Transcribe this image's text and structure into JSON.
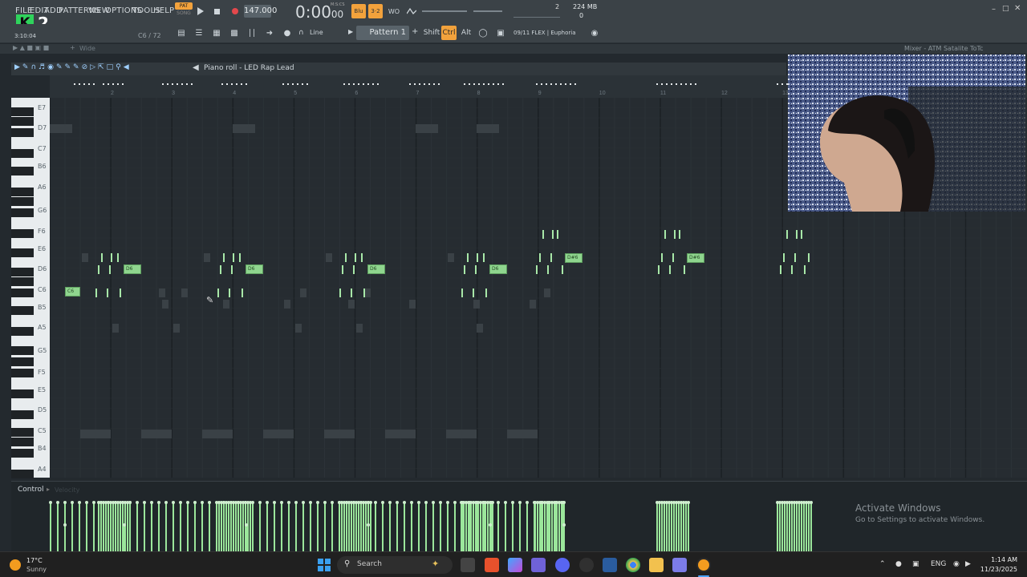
{
  "app": {
    "menu": [
      "FILE",
      "EDIT",
      "ADD",
      "PATTERNS",
      "VIEW",
      "OPTIONS",
      "TOOLS",
      "HELP"
    ],
    "pat_song": [
      "PAT",
      "SONG"
    ],
    "tempo": "147.000",
    "time_main": "0:00",
    "time_sub": "00",
    "time_unit": "M:S:CS",
    "memory": "224 MB",
    "cpu_num": "2",
    "cpu_zero": "0",
    "elapsed": "3:10:04",
    "big_number": "2",
    "note_info": "C6 / 72",
    "snap": "Line",
    "pattern": "Pattern 1",
    "shift": "Shift",
    "ctrl": "Ctrl",
    "alt": "Alt",
    "plugin_info": "09/11  FLEX | Euphoria",
    "channel_rack_label": "Wide",
    "mixer_title": "Mixer - ATM Satalite ToTc"
  },
  "piano_roll": {
    "title": "Piano roll - LED Rap Lead",
    "bar_numbers": [
      "2",
      "3",
      "4",
      "5",
      "6",
      "7",
      "8",
      "9",
      "10",
      "11",
      "12",
      "13"
    ],
    "keys": [
      "E7",
      "D7",
      "C7",
      "B6",
      "A6",
      "G6",
      "F6",
      "E6",
      "D6",
      "C6",
      "B5",
      "A5",
      "G5",
      "F5",
      "E5",
      "D5",
      "C5",
      "B4",
      "A4"
    ],
    "note_labels": {
      "c6": "C6",
      "d6": "D6",
      "ds6": "D#6"
    }
  },
  "control": {
    "label": "Control",
    "sub_label": "Velocity"
  },
  "watermark": {
    "title": "Activate Windows",
    "subtitle": "Go to Settings to activate Windows."
  },
  "taskbar": {
    "weather_temp": "17°C",
    "weather_desc": "Sunny",
    "search_placeholder": "Search",
    "lang": "ENG",
    "time": "1:14 AM",
    "date": "11/23/2025"
  },
  "colors": {
    "note_green": "#8fd58e",
    "accent_orange": "#f2a23c",
    "grid_bg": "#262c31"
  }
}
